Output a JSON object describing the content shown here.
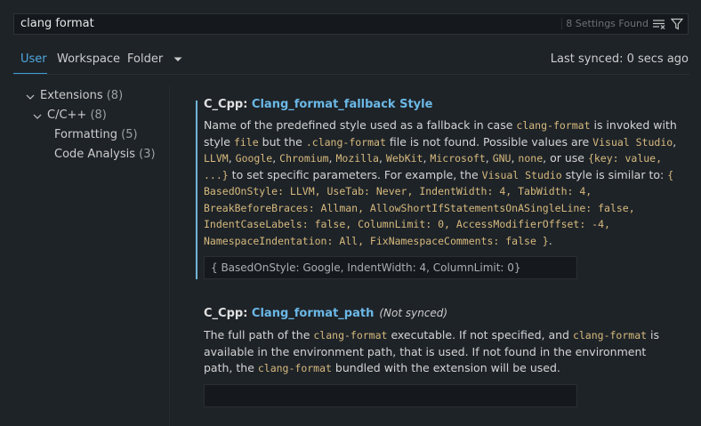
{
  "search": {
    "value": "clang format",
    "results_count": "8 Settings Found"
  },
  "tabs": [
    {
      "label": "User"
    },
    {
      "label": "Workspace"
    },
    {
      "label": "Folder"
    }
  ],
  "last_synced": "Last synced: 0 secs ago",
  "tree": {
    "extensions": {
      "label": "Extensions",
      "count": "(8)"
    },
    "cpp": {
      "label": "C/C++",
      "count": "(8)"
    },
    "formatting": {
      "label": "Formatting",
      "count": "(5)"
    },
    "code_analysis": {
      "label": "Code Analysis",
      "count": "(3)"
    }
  },
  "settings": [
    {
      "category": "C_Cpp: ",
      "name": "Clang_format_fallback Style",
      "desc": {
        "t1": "Name of the predefined style used as a fallback in case ",
        "c1": "clang-format",
        "t2": " is invoked with style ",
        "c2": "file",
        "t3": " but the ",
        "c3": ".clang-format",
        "t4": " file is not found. Possible values are ",
        "c4": "Visual Studio",
        "s1": ", ",
        "c5": "LLVM",
        "s2": ", ",
        "c6": "Google",
        "s3": ", ",
        "c7": "Chromium",
        "s4": ", ",
        "c8": "Mozilla",
        "s5": ", ",
        "c9": "WebKit",
        "s6": ", ",
        "c10": "Microsoft",
        "s7": ", ",
        "c11": "GNU",
        "s8": ", ",
        "c12": "none",
        "t5": ", or use ",
        "c13": "{key: value, ...}",
        "t6": " to set specific parameters. For example, the ",
        "c14": "Visual Studio",
        "t7": " style is similar to: ",
        "c15": "{ BasedOnStyle: LLVM, UseTab: Never, IndentWidth: 4, TabWidth: 4, BreakBeforeBraces: Allman, AllowShortIfStatementsOnASingleLine: false, IndentCaseLabels: false, ColumnLimit: 0, AccessModifierOffset: -4, NamespaceIndentation: All, FixNamespaceComments: false }",
        "t8": "."
      },
      "value": "{ BasedOnStyle: Google, IndentWidth: 4, ColumnLimit: 0}"
    },
    {
      "category": "C_Cpp: ",
      "name": "Clang_format_path",
      "not_synced": "(Not synced)",
      "desc": {
        "t1": "The full path of the ",
        "c1": "clang-format",
        "t2": " executable. If not specified, and ",
        "c2": "clang-format",
        "t3": " is available in the environment path, that is used. If not found in the environment path, the ",
        "c3": "clang-format",
        "t4": " bundled with the extension will be used."
      },
      "value": ""
    }
  ],
  "colors": {
    "background": "#1e2328",
    "accent": "#4ea9df",
    "code": "#d7ba7d",
    "modified_bar": "#6fb5d8"
  }
}
